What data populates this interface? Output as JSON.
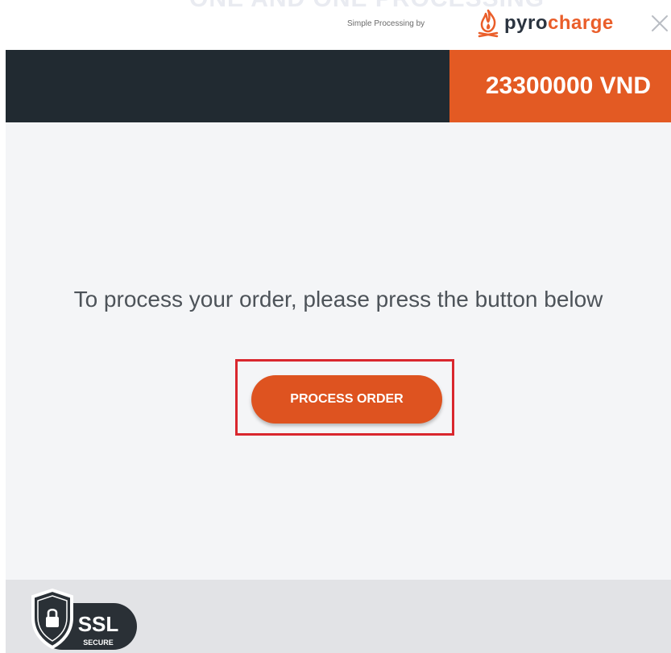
{
  "header": {
    "ghost_text": "ONE AND ONE PROCESSING",
    "simple_processing_label": "Simple Processing by",
    "brand": {
      "name_part1": "pyro",
      "name_part2": "charge",
      "icon": "flame-logo-icon"
    },
    "close_icon": "close-icon"
  },
  "order": {
    "amount": "23300000 VND"
  },
  "main": {
    "message": "To process your order, please press the button below",
    "button_label": "PROCESS ORDER"
  },
  "footer": {
    "ssl_label": "SSL",
    "secure_label": "SECURE",
    "badge_icon": "shield-lock-icon"
  },
  "colors": {
    "accent": "#e35a23",
    "dark_bar": "#212a31",
    "background": "#f4f5f7",
    "highlight": "#d9272e"
  }
}
